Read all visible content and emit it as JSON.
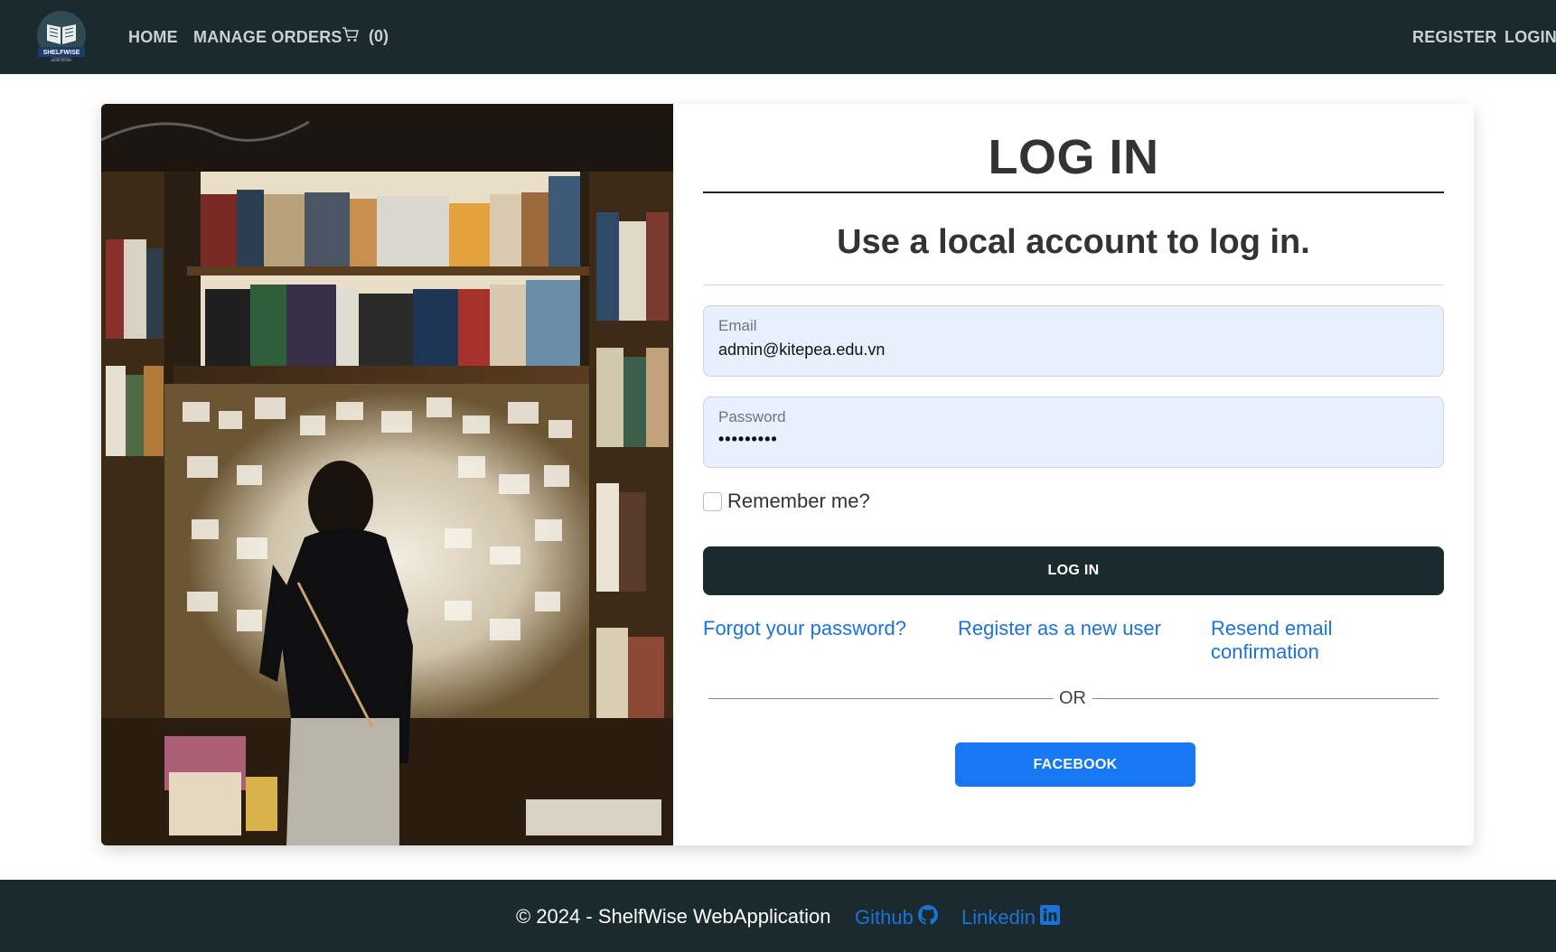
{
  "header": {
    "logo_text": "SHELFWISE",
    "logo_tagline": "BOOK STORE",
    "nav": {
      "home": "HOME",
      "manage_orders": "MANAGE ORDERS",
      "cart_count": "(0)",
      "register": "REGISTER",
      "login": "LOGIN"
    }
  },
  "login_form": {
    "title": "LOG IN",
    "subtitle": "Use a local account to log in.",
    "email": {
      "label": "Email",
      "value": "admin@kitepea.edu.vn"
    },
    "password": {
      "label": "Password",
      "value": "•••••••••"
    },
    "remember_label": "Remember me?",
    "remember_checked": false,
    "submit_label": "LOG IN",
    "links": {
      "forgot": "Forgot your password?",
      "register": "Register as a new user",
      "resend": "Resend email confirmation"
    },
    "divider_text": "OR",
    "facebook_label": "FACEBOOK"
  },
  "footer": {
    "copyright": "© 2024 - ShelfWise WebApplication",
    "github": "Github",
    "linkedin": "Linkedin"
  },
  "colors": {
    "navbar_bg": "#1b2a2e",
    "link": "#1a73d9",
    "facebook": "#1877f2",
    "input_bg": "#e8f0fe"
  },
  "icons": {
    "cart": "cart-icon",
    "github": "github-icon",
    "linkedin": "linkedin-icon",
    "logo": "open-book-logo"
  }
}
